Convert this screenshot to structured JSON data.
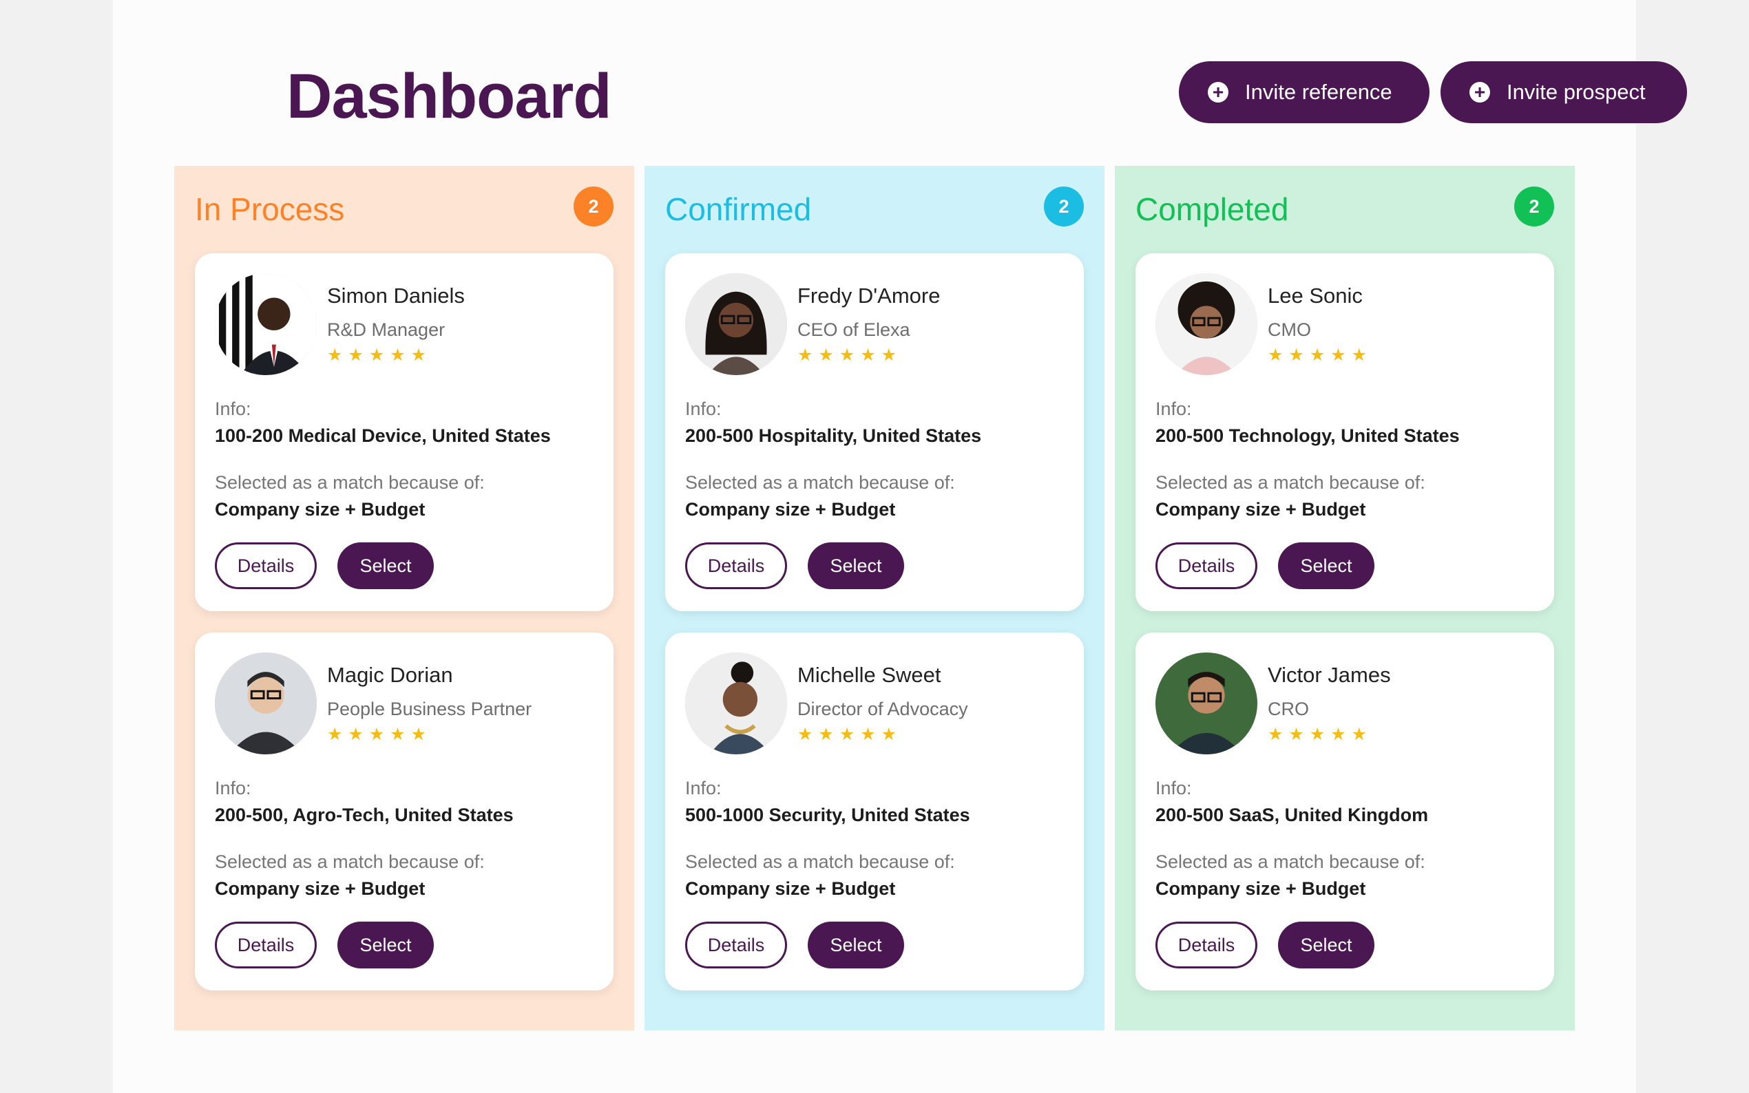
{
  "page": {
    "title": "Dashboard"
  },
  "header": {
    "invite_reference": "Invite reference",
    "invite_prospect": "Invite prospect",
    "plus_icon": "+"
  },
  "colors": {
    "brand": "#4a1752",
    "in_process_bg": "#fee4d3",
    "in_process_accent": "#fb8227",
    "confirmed_bg": "#cdf2f9",
    "confirmed_accent": "#1cbde2",
    "completed_bg": "#cdf1dd",
    "completed_accent": "#12c155",
    "star": "#f5bd14"
  },
  "columns": [
    {
      "title": "In Process",
      "count": "2",
      "cards": [
        {
          "name": "Simon Daniels",
          "role": "R&D Manager",
          "stars": "★★★★★",
          "info_label": "Info:",
          "info": "100-200 Medical Device, United States",
          "match_label": "Selected as a match because of:",
          "match": "Company size + Budget",
          "details": "Details",
          "select": "Select"
        },
        {
          "name": "Magic Dorian",
          "role": "People Business Partner",
          "stars": "★★★★★",
          "info_label": "Info:",
          "info": "200-500, Agro-Tech, United States",
          "match_label": "Selected as a match because of:",
          "match": "Company size + Budget",
          "details": "Details",
          "select": "Select"
        }
      ]
    },
    {
      "title": "Confirmed",
      "count": "2",
      "cards": [
        {
          "name": "Fredy D'Amore",
          "role": "CEO of Elexa",
          "stars": "★★★★★",
          "info_label": "Info:",
          "info": "200-500 Hospitality, United States",
          "match_label": "Selected as a match because of:",
          "match": "Company size + Budget",
          "details": "Details",
          "select": "Select"
        },
        {
          "name": "Michelle Sweet",
          "role": "Director of Advocacy",
          "stars": "★★★★★",
          "info_label": "Info:",
          "info": "500-1000 Security, United States",
          "match_label": "Selected as a match because of:",
          "match": "Company size + Budget",
          "details": "Details",
          "select": "Select"
        }
      ]
    },
    {
      "title": "Completed",
      "count": "2",
      "cards": [
        {
          "name": "Lee Sonic",
          "role": "CMO",
          "stars": "★★★★★",
          "info_label": "Info:",
          "info": "200-500 Technology, United States",
          "match_label": "Selected as a match because of:",
          "match": "Company size + Budget",
          "details": "Details",
          "select": "Select"
        },
        {
          "name": "Victor James",
          "role": "CRO",
          "stars": "★★★★★",
          "info_label": "Info:",
          "info": "200-500 SaaS, United Kingdom",
          "match_label": "Selected as a match because of:",
          "match": "Company size + Budget",
          "details": "Details",
          "select": "Select"
        }
      ]
    }
  ]
}
